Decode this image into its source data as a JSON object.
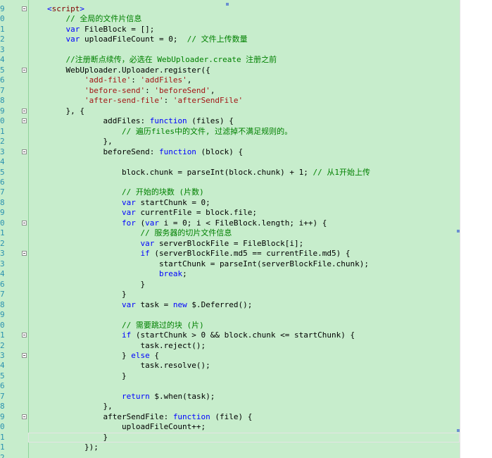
{
  "colors": {
    "editor_bg": "#c7edcc",
    "keyword": "#0000ff",
    "comment": "#008000",
    "string": "#a31515",
    "line_number": "#2b91af"
  },
  "editor": {
    "lines": [
      {
        "num": "9",
        "fold": true,
        "segments": [
          {
            "t": "<",
            "c": "kw"
          },
          {
            "t": "script",
            "c": "tg"
          },
          {
            "t": ">",
            "c": "kw"
          }
        ]
      },
      {
        "num": "0",
        "fold": false,
        "segments": [
          {
            "t": "    // 全局的文件片信息",
            "c": "cm"
          }
        ]
      },
      {
        "num": "1",
        "fold": false,
        "segments": [
          {
            "t": "    ",
            "c": "nb"
          },
          {
            "t": "var",
            "c": "kw"
          },
          {
            "t": " FileBlock = [];",
            "c": "nb"
          }
        ]
      },
      {
        "num": "2",
        "fold": false,
        "segments": [
          {
            "t": "    ",
            "c": "nb"
          },
          {
            "t": "var",
            "c": "kw"
          },
          {
            "t": " uploadFileCount = 0;  ",
            "c": "nb"
          },
          {
            "t": "// 文件上传数量",
            "c": "cm"
          }
        ]
      },
      {
        "num": "3",
        "fold": false,
        "segments": [
          {
            "t": "",
            "c": "nb"
          }
        ]
      },
      {
        "num": "4",
        "fold": false,
        "segments": [
          {
            "t": "    //注册断点续传，必选在 WebUploader.create 注册之前",
            "c": "cm"
          }
        ]
      },
      {
        "num": "5",
        "fold": true,
        "segments": [
          {
            "t": "    WebUploader.Uploader.register({",
            "c": "nb"
          }
        ]
      },
      {
        "num": "6",
        "fold": false,
        "segments": [
          {
            "t": "        ",
            "c": "nb"
          },
          {
            "t": "'add-file'",
            "c": "st"
          },
          {
            "t": ": ",
            "c": "nb"
          },
          {
            "t": "'addFiles'",
            "c": "st"
          },
          {
            "t": ",",
            "c": "nb"
          }
        ]
      },
      {
        "num": "7",
        "fold": false,
        "segments": [
          {
            "t": "        ",
            "c": "nb"
          },
          {
            "t": "'before-send'",
            "c": "st"
          },
          {
            "t": ": ",
            "c": "nb"
          },
          {
            "t": "'beforeSend'",
            "c": "st"
          },
          {
            "t": ",",
            "c": "nb"
          }
        ]
      },
      {
        "num": "8",
        "fold": false,
        "segments": [
          {
            "t": "        ",
            "c": "nb"
          },
          {
            "t": "'after-send-file'",
            "c": "st"
          },
          {
            "t": ": ",
            "c": "nb"
          },
          {
            "t": "'afterSendFile'",
            "c": "st"
          }
        ]
      },
      {
        "num": "9",
        "fold": true,
        "segments": [
          {
            "t": "    }, {",
            "c": "nb"
          }
        ]
      },
      {
        "num": "0",
        "fold": true,
        "segments": [
          {
            "t": "            addFiles: ",
            "c": "nb"
          },
          {
            "t": "function",
            "c": "kw"
          },
          {
            "t": " (files) {",
            "c": "nb"
          }
        ]
      },
      {
        "num": "1",
        "fold": false,
        "segments": [
          {
            "t": "                // 遍历files中的文件, 过滤掉不满足规则的。",
            "c": "cm"
          }
        ]
      },
      {
        "num": "2",
        "fold": false,
        "segments": [
          {
            "t": "            },",
            "c": "nb"
          }
        ]
      },
      {
        "num": "3",
        "fold": true,
        "segments": [
          {
            "t": "            beforeSend: ",
            "c": "nb"
          },
          {
            "t": "function",
            "c": "kw"
          },
          {
            "t": " (block) {",
            "c": "nb"
          }
        ]
      },
      {
        "num": "4",
        "fold": false,
        "segments": [
          {
            "t": "",
            "c": "nb"
          }
        ]
      },
      {
        "num": "5",
        "fold": false,
        "segments": [
          {
            "t": "                block.chunk = parseInt(block.chunk) + 1; ",
            "c": "nb"
          },
          {
            "t": "// 从1开始上传",
            "c": "cm"
          }
        ]
      },
      {
        "num": "6",
        "fold": false,
        "segments": [
          {
            "t": "",
            "c": "nb"
          }
        ]
      },
      {
        "num": "7",
        "fold": false,
        "segments": [
          {
            "t": "                // 开始的块数 (片数)",
            "c": "cm"
          }
        ]
      },
      {
        "num": "8",
        "fold": false,
        "segments": [
          {
            "t": "                ",
            "c": "nb"
          },
          {
            "t": "var",
            "c": "kw"
          },
          {
            "t": " startChunk = 0;",
            "c": "nb"
          }
        ]
      },
      {
        "num": "9",
        "fold": false,
        "segments": [
          {
            "t": "                ",
            "c": "nb"
          },
          {
            "t": "var",
            "c": "kw"
          },
          {
            "t": " currentFile = block.file;",
            "c": "nb"
          }
        ]
      },
      {
        "num": "0",
        "fold": true,
        "segments": [
          {
            "t": "                ",
            "c": "nb"
          },
          {
            "t": "for",
            "c": "kw"
          },
          {
            "t": " (",
            "c": "nb"
          },
          {
            "t": "var",
            "c": "kw"
          },
          {
            "t": " i = 0; i < FileBlock.length; i++) {",
            "c": "nb"
          }
        ]
      },
      {
        "num": "1",
        "fold": false,
        "segments": [
          {
            "t": "                    // 服务器的切片文件信息",
            "c": "cm"
          }
        ]
      },
      {
        "num": "2",
        "fold": false,
        "segments": [
          {
            "t": "                    ",
            "c": "nb"
          },
          {
            "t": "var",
            "c": "kw"
          },
          {
            "t": " serverBlockFile = FileBlock[i];",
            "c": "nb"
          }
        ]
      },
      {
        "num": "3",
        "fold": true,
        "segments": [
          {
            "t": "                    ",
            "c": "nb"
          },
          {
            "t": "if",
            "c": "kw"
          },
          {
            "t": " (serverBlockFile.md5 == currentFile.md5) {",
            "c": "nb"
          }
        ]
      },
      {
        "num": "3",
        "fold": false,
        "segments": [
          {
            "t": "                        startChunk = parseInt(serverBlockFile.chunk);",
            "c": "nb"
          }
        ]
      },
      {
        "num": "4",
        "fold": false,
        "segments": [
          {
            "t": "                        ",
            "c": "nb"
          },
          {
            "t": "break",
            "c": "kw"
          },
          {
            "t": ";",
            "c": "nb"
          }
        ]
      },
      {
        "num": "6",
        "fold": false,
        "segments": [
          {
            "t": "                    }",
            "c": "nb"
          }
        ]
      },
      {
        "num": "7",
        "fold": false,
        "segments": [
          {
            "t": "                }",
            "c": "nb"
          }
        ]
      },
      {
        "num": "8",
        "fold": false,
        "segments": [
          {
            "t": "                ",
            "c": "nb"
          },
          {
            "t": "var",
            "c": "kw"
          },
          {
            "t": " task = ",
            "c": "nb"
          },
          {
            "t": "new",
            "c": "kw"
          },
          {
            "t": " $.Deferred();",
            "c": "nb"
          }
        ]
      },
      {
        "num": "9",
        "fold": false,
        "segments": [
          {
            "t": "",
            "c": "nb"
          }
        ]
      },
      {
        "num": "0",
        "fold": false,
        "segments": [
          {
            "t": "                // 需要跳过的块 (片)",
            "c": "cm"
          }
        ]
      },
      {
        "num": "1",
        "fold": true,
        "segments": [
          {
            "t": "                ",
            "c": "nb"
          },
          {
            "t": "if",
            "c": "kw"
          },
          {
            "t": " (startChunk > 0 && block.chunk <= startChunk) {",
            "c": "nb"
          }
        ]
      },
      {
        "num": "2",
        "fold": false,
        "segments": [
          {
            "t": "                    task.reject();",
            "c": "nb"
          }
        ]
      },
      {
        "num": "3",
        "fold": true,
        "segments": [
          {
            "t": "                } ",
            "c": "nb"
          },
          {
            "t": "else",
            "c": "kw"
          },
          {
            "t": " {",
            "c": "nb"
          }
        ]
      },
      {
        "num": "4",
        "fold": false,
        "segments": [
          {
            "t": "                    task.resolve();",
            "c": "nb"
          }
        ]
      },
      {
        "num": "5",
        "fold": false,
        "segments": [
          {
            "t": "                }",
            "c": "nb"
          }
        ]
      },
      {
        "num": "6",
        "fold": false,
        "segments": [
          {
            "t": "",
            "c": "nb"
          }
        ]
      },
      {
        "num": "7",
        "fold": false,
        "segments": [
          {
            "t": "                ",
            "c": "nb"
          },
          {
            "t": "return",
            "c": "kw"
          },
          {
            "t": " $.when(task);",
            "c": "nb"
          }
        ]
      },
      {
        "num": "8",
        "fold": false,
        "segments": [
          {
            "t": "            },",
            "c": "nb"
          }
        ]
      },
      {
        "num": "9",
        "fold": true,
        "segments": [
          {
            "t": "            afterSendFile: ",
            "c": "nb"
          },
          {
            "t": "function",
            "c": "kw"
          },
          {
            "t": " (file) {",
            "c": "nb"
          }
        ]
      },
      {
        "num": "0",
        "fold": false,
        "segments": [
          {
            "t": "                uploadFileCount++;",
            "c": "nb"
          }
        ]
      },
      {
        "num": "1",
        "fold": false,
        "segments": [
          {
            "t": "            }",
            "c": "nb"
          }
        ]
      },
      {
        "num": "1",
        "fold": false,
        "segments": [
          {
            "t": "        });",
            "c": "nb"
          }
        ]
      },
      {
        "num": "2",
        "fold": false,
        "segments": [
          {
            "t": "",
            "c": "nb"
          }
        ]
      }
    ]
  }
}
